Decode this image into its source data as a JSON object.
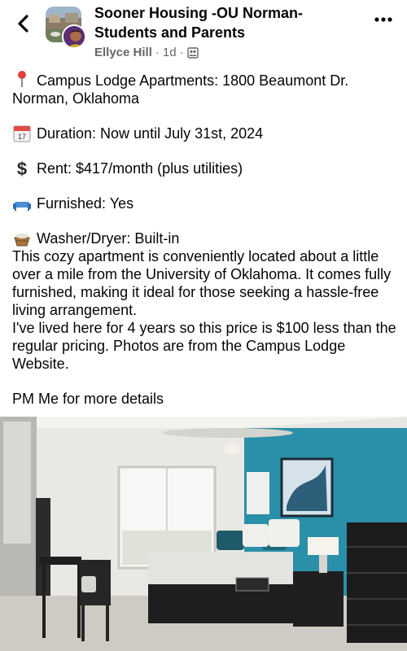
{
  "header": {
    "group_name": "Sooner Housing -OU Norman- Students and Parents",
    "author": "Ellyce Hill",
    "time": "1d",
    "dot": "·",
    "icons": {
      "back": "back-chevron-icon",
      "more": "more-dots-icon",
      "audience": "group-audience-icon"
    }
  },
  "post": {
    "location": {
      "icon": "pin-icon",
      "text": "Campus Lodge Apartments: 1800 Beaumont Dr. Norman, Oklahoma"
    },
    "duration": {
      "icon": "calendar-icon",
      "text": "Duration: Now until July 31st, 2024"
    },
    "rent": {
      "icon": "dollar-icon",
      "text": "Rent: $417/month (plus utilities)"
    },
    "furnished": {
      "icon": "couch-icon",
      "text": "Furnished: Yes"
    },
    "washer": {
      "icon": "basket-icon",
      "text": "Washer/Dryer: Built-in"
    },
    "description": "This cozy apartment is conveniently located about a little over a mile from the University of Oklahoma. It comes fully furnished, making it ideal for those seeking a hassle-free living arrangement.",
    "history": "I've lived here for 4 years so this price is $100 less than the regular pricing. Photos are from the Campus Lodge Website.",
    "cta": "PM Me for more details"
  },
  "colors": {
    "accent_wall": "#2a8fa8",
    "meta_gray": "#65676b",
    "text": "#050505"
  }
}
